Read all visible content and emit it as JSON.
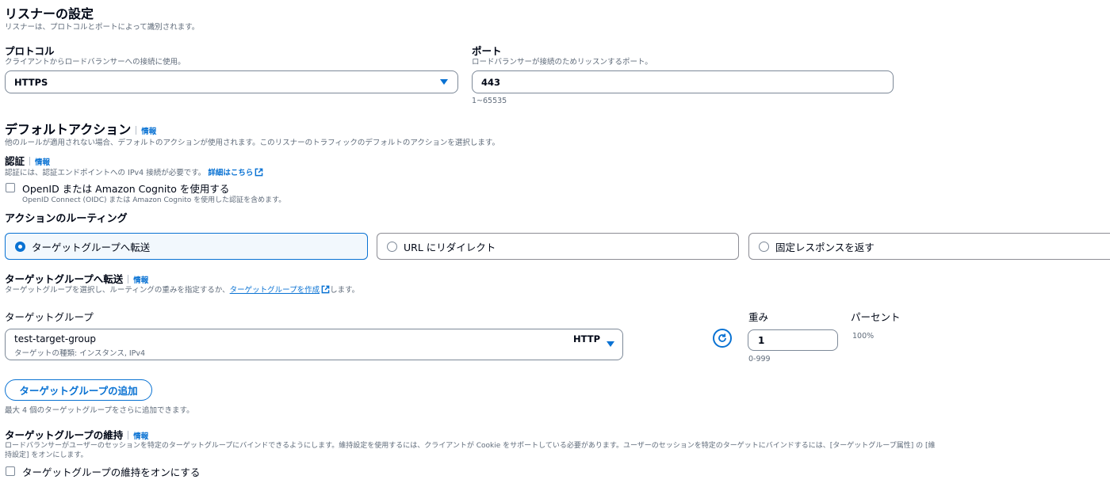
{
  "listener": {
    "title": "リスナーの設定",
    "description": "リスナーは、プロトコルとポートによって識別されます。"
  },
  "protocol": {
    "label": "プロトコル",
    "description": "クライアントからロードバランサーへの接続に使用。",
    "value": "HTTPS"
  },
  "port": {
    "label": "ポート",
    "description": "ロードバランサーが接続のためリッスンするポート。",
    "value": "443",
    "hint": "1~65535"
  },
  "default_action": {
    "title": "デフォルトアクション",
    "info": "情報",
    "description": "他のルールが適用されない場合、デフォルトのアクションが使用されます。このリスナーのトラフィックのデフォルトのアクションを選択します。"
  },
  "auth": {
    "title": "認証",
    "info": "情報",
    "description": "認証には、認証エンドポイントへの IPv4 接続が必要です。",
    "link": "詳細はこちら",
    "checkbox_label": "OpenID または Amazon Cognito を使用する",
    "checkbox_description": "OpenID Connect (OIDC) または Amazon Cognito を使用した認証を含めます。",
    "checked": false
  },
  "routing": {
    "title": "アクションのルーティング",
    "options": [
      {
        "label": "ターゲットグループへ転送",
        "selected": true
      },
      {
        "label": "URL にリダイレクト",
        "selected": false
      },
      {
        "label": "固定レスポンスを返す",
        "selected": false
      }
    ]
  },
  "forward": {
    "title": "ターゲットグループへ転送",
    "info": "情報",
    "description_pre": "ターゲットグループを選択し、ルーティングの重みを指定するか、",
    "description_link": "ターゲットグループを作成",
    "description_post": "します。"
  },
  "target_group": {
    "column_label": "ターゲットグループ",
    "weight_label": "重み",
    "percent_label": "パーセント",
    "name": "test-target-group",
    "subtext": "ターゲットの種類: インスタンス, IPv4",
    "protocol": "HTTP",
    "weight": "1",
    "weight_hint": "0-999",
    "percent": "100%"
  },
  "add_group": {
    "button": "ターゲットグループの追加",
    "hint": "最大 4 個のターゲットグループをさらに追加できます。"
  },
  "stickiness": {
    "title": "ターゲットグループの維持",
    "info": "情報",
    "description_line1": "ロードバランサーがユーザーのセッションを特定のターゲットグループにバインドできるようにします。維持設定を使用するには、クライアントが Cookie をサポートしている必要があります。ユーザーのセッションを特定のターゲットにバインドするには、[ターゲットグループ属性] の [維",
    "description_line2": "持設定] をオンにします。",
    "checkbox_label": "ターゲットグループの維持をオンにする",
    "checked": false
  },
  "colors": {
    "accent": "#0972d3",
    "text": "#000716",
    "muted": "#5f6b7a",
    "border": "#7d8998",
    "selected_bg": "#f2f8fd"
  }
}
